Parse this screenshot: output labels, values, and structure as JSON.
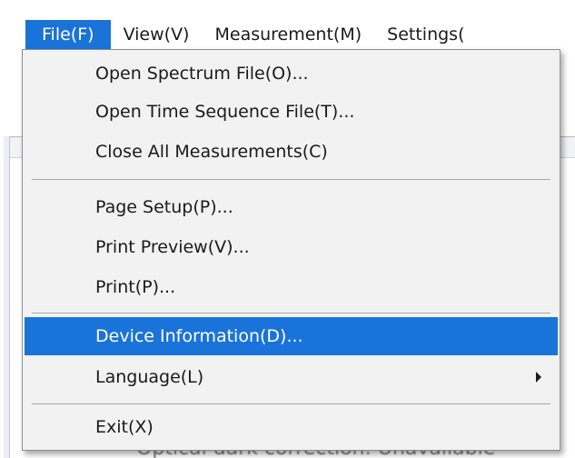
{
  "menubar": {
    "items": [
      {
        "label": "File(F)",
        "active": true
      },
      {
        "label": "View(V)",
        "active": false
      },
      {
        "label": "Measurement(M)",
        "active": false
      },
      {
        "label": "Settings(",
        "active": false
      }
    ]
  },
  "file_menu": {
    "groups": [
      [
        "Open Spectrum File(O)...",
        "Open Time Sequence File(T)...",
        "Close All Measurements(C)"
      ],
      [
        "Page Setup(P)...",
        "Print Preview(V)...",
        "Print(P)..."
      ],
      [
        "Device Information(D)...",
        "Language(L)"
      ],
      [
        "Exit(X)"
      ]
    ],
    "highlighted_item": "Device Information(D)...",
    "submenu_item": "Language(L)"
  },
  "background": {
    "partial_text": "Optical dark correction: Unavailable"
  },
  "colors": {
    "highlight": "#1a73d8",
    "menu_bg": "#f2f2f2",
    "text": "#1a1a1a"
  }
}
